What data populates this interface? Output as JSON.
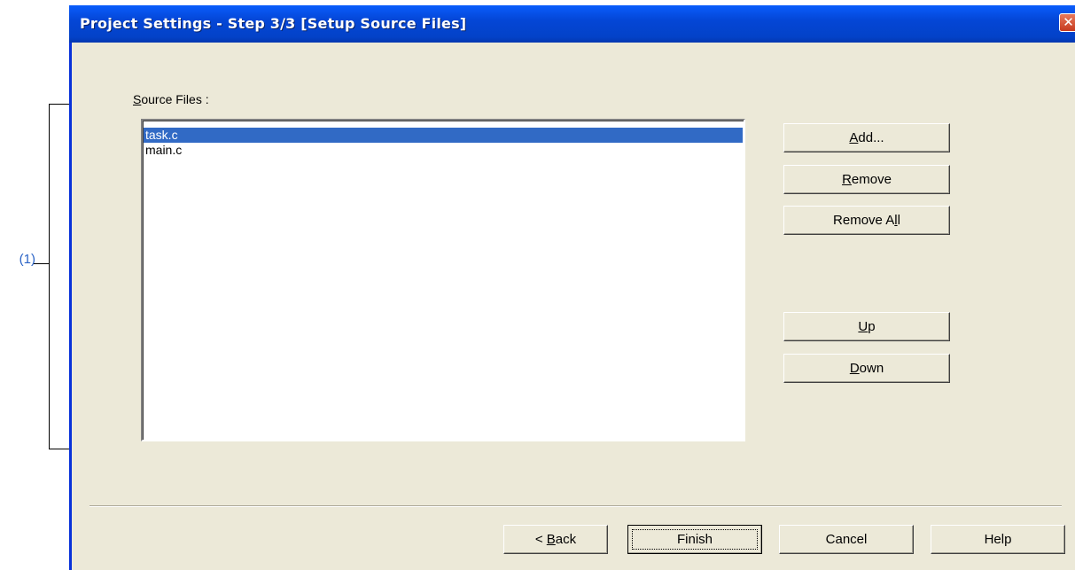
{
  "annotation": {
    "label": "(1)"
  },
  "dialog": {
    "title": "Project Settings - Step 3/3 [Setup Source Files]",
    "close_glyph": "✕"
  },
  "source_files": {
    "label_access": "S",
    "label_rest": "ource Files :",
    "items": [
      "task.c",
      "main.c"
    ],
    "selected_index": 0
  },
  "buttons": {
    "add": {
      "access": "A",
      "rest": "dd..."
    },
    "remove": {
      "access": "R",
      "rest": "emove"
    },
    "remove_all": {
      "pre": "Remove A",
      "access": "l",
      "rest": "l"
    },
    "up": {
      "access": "U",
      "rest": "p"
    },
    "down": {
      "access": "D",
      "rest": "own"
    },
    "back": {
      "pre": "< ",
      "access": "B",
      "rest": "ack"
    },
    "finish": {
      "label": "Finish"
    },
    "cancel": {
      "label": "Cancel"
    },
    "help": {
      "label": "Help"
    }
  },
  "colors": {
    "titlebar": "#0446d6",
    "dialog_bg": "#ece9d8",
    "selection": "#316ac5",
    "annotation": "#2a63c6"
  }
}
